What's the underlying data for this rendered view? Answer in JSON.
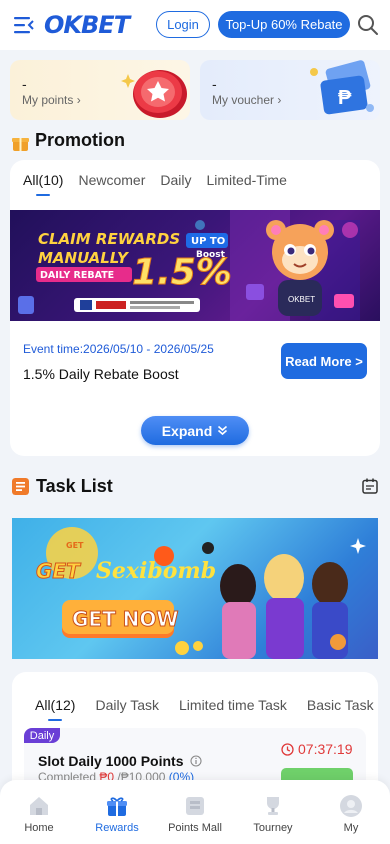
{
  "header": {
    "logo_text": "OKBET",
    "login_label": "Login",
    "topup_label": "Top-Up 60% Rebate"
  },
  "points_card": {
    "value": "-",
    "label": "My points",
    "chevron": "›"
  },
  "voucher_card": {
    "value": "-",
    "label": "My voucher",
    "chevron": "›"
  },
  "promotion": {
    "title": "Promotion",
    "tabs": [
      {
        "label": "All(10)",
        "active": true
      },
      {
        "label": "Newcomer",
        "active": false
      },
      {
        "label": "Daily",
        "active": false
      },
      {
        "label": "Limited-Time",
        "active": false
      }
    ],
    "banner": {
      "line1": "CLAIM REWARDS",
      "line1b": "UP TO",
      "line2": "MANUALLY",
      "line3": "DAILY REBATE",
      "big": "1.5%",
      "boost": "Boost"
    },
    "event_time": "Event time:2026/05/10 - 2026/05/25",
    "name": "1.5% Daily Rebate Boost",
    "read_more_label": "Read More >",
    "expand_label": "Expand"
  },
  "task_list": {
    "title": "Task List",
    "banner": {
      "get": "GET",
      "brand": "Sexibomb",
      "cta": "GET NOW"
    },
    "tabs": [
      {
        "label": "All(12)",
        "active": true
      },
      {
        "label": "Daily Task",
        "active": false
      },
      {
        "label": "Limited time Task",
        "active": false
      },
      {
        "label": "Basic Task",
        "active": false
      }
    ],
    "task": {
      "badge": "Daily",
      "name": "Slot Daily 1000 Points",
      "progress_prefix": "Completed ",
      "progress_done": "₱0",
      "progress_total": " /₱10,000 ",
      "progress_pct": "(0%)",
      "timer": "07:37:19"
    }
  },
  "bottom_nav": [
    {
      "label": "Home",
      "active": false
    },
    {
      "label": "Rewards",
      "active": true
    },
    {
      "label": "Points Mall",
      "active": false
    },
    {
      "label": "Tourney",
      "active": false
    },
    {
      "label": "My",
      "active": false
    }
  ],
  "colors": {
    "brand_blue": "#1f6be0",
    "timer_red": "#e03a3a",
    "daily_badge": "#6a3fd6"
  }
}
